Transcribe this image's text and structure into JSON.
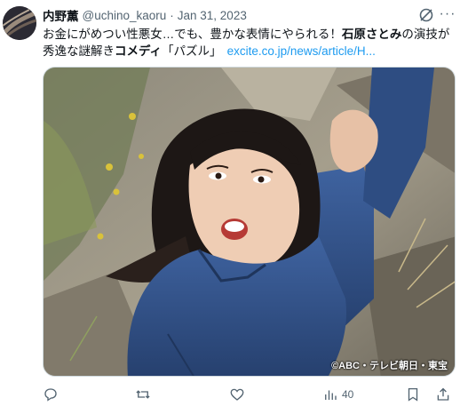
{
  "tweet": {
    "display_name": "内野薫",
    "handle": "@uchino_kaoru",
    "separator": "·",
    "date": "Jan 31, 2023",
    "text_part1": "お金にがめつい性悪女…でも、豊かな表情にやられる！",
    "text_bold1": "石原さとみ",
    "text_part2": "の演技が",
    "text_part3": "秀逸な謎解き",
    "text_bold2": "コメディ",
    "text_part4": "「パズル」",
    "link_text": "excite.co.jp/news/article/H...",
    "image_credit": "©ABC・テレビ朝日・東宝"
  },
  "actions": {
    "reply_icon": "reply-icon",
    "retweet_icon": "retweet-icon",
    "like_icon": "heart-icon",
    "views_icon": "views-icon",
    "views_count": "40",
    "bookmark_icon": "bookmark-icon",
    "share_icon": "share-icon"
  },
  "colors": {
    "link": "#1d9bf0",
    "secondary_text": "#536471",
    "jacket": "#2f4f86"
  }
}
